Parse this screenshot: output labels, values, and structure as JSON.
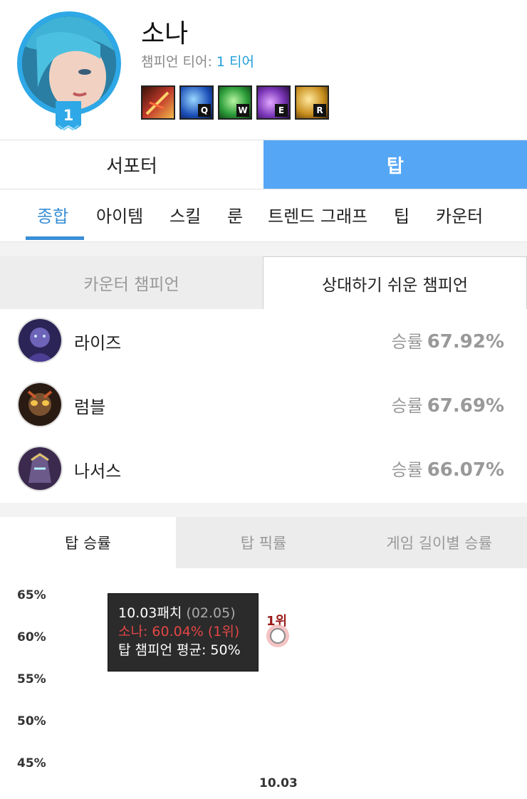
{
  "header": {
    "champion_name": "소나",
    "tier_label": "챔피언 티어:",
    "tier_value": "1 티어",
    "tier_badge": "1",
    "skills": [
      {
        "key": "",
        "icon": "passive-icon",
        "color": "#c0392b"
      },
      {
        "key": "Q",
        "icon": "q-skill-icon",
        "color": "#1c4fb8"
      },
      {
        "key": "W",
        "icon": "w-skill-icon",
        "color": "#2e9e3b"
      },
      {
        "key": "E",
        "icon": "e-skill-icon",
        "color": "#7b36b8"
      },
      {
        "key": "R",
        "icon": "r-skill-icon",
        "color": "#c9901f"
      }
    ]
  },
  "role_tabs": [
    {
      "label": "서포터",
      "active": false
    },
    {
      "label": "탑",
      "active": true
    }
  ],
  "subnav": [
    "종합",
    "아이템",
    "스킬",
    "룬",
    "트렌드 그래프",
    "팁",
    "카운터"
  ],
  "counter_tabs": [
    {
      "label": "카운터 챔피언",
      "active": false
    },
    {
      "label": "상대하기 쉬운 챔피언",
      "active": true
    }
  ],
  "matchups": [
    {
      "name": "라이즈",
      "rate_label": "승률",
      "rate": "67.92%"
    },
    {
      "name": "럼블",
      "rate_label": "승률",
      "rate": "67.69%"
    },
    {
      "name": "나서스",
      "rate_label": "승률",
      "rate": "66.07%"
    }
  ],
  "graph_tabs": [
    {
      "label": "탑 승률",
      "active": true
    },
    {
      "label": "탑 픽률",
      "active": false
    },
    {
      "label": "게임 길이별 승률",
      "active": false
    }
  ],
  "tooltip": {
    "patch": "10.03패치",
    "date": "(02.05)",
    "champion_line": "소나: 60.04% (1위)",
    "average_line": "탑 챔피언 평균: 50%"
  },
  "colors": {
    "accent": "#55a7f5",
    "tier_blue": "#1e9ed9",
    "highlight_red": "#e44646",
    "point_ring": "#f2b8b8"
  },
  "chart_data": {
    "type": "line",
    "x": [
      "10.03"
    ],
    "series": [
      {
        "values": [
          60.04
        ]
      }
    ],
    "y_ticks": [
      "65%",
      "60%",
      "55%",
      "50%",
      "45%"
    ],
    "ylim": [
      45,
      65
    ],
    "point_label": "1위",
    "grid": false
  }
}
